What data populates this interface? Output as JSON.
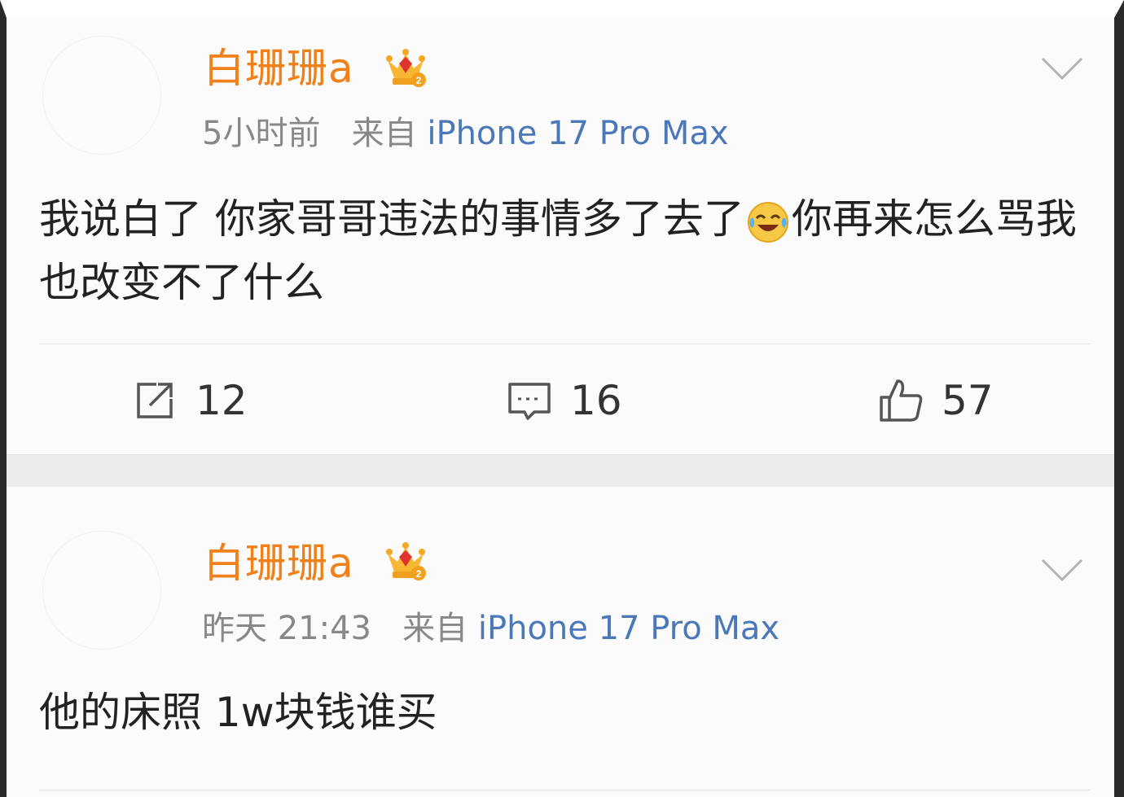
{
  "posts": [
    {
      "username": "白珊珊a",
      "time": "5小时前",
      "source_prefix": "来自",
      "source": "iPhone 17 Pro Max",
      "content_a": "我说白了 你家哥哥违法的事情多了去了",
      "emoji": "laughing-crying-emoji",
      "content_b": "你再来怎么骂我也改变不了什么",
      "repost_count": "12",
      "comment_count": "16",
      "like_count": "57"
    },
    {
      "username": "白珊珊a",
      "time": "昨天 21:43",
      "source_prefix": "来自",
      "source": "iPhone 17 Pro Max",
      "content": "他的床照 1w块钱谁买"
    }
  ],
  "colors": {
    "username": "#f08119",
    "meta": "#888888",
    "source_link": "#4a78b8",
    "text": "#222222"
  }
}
